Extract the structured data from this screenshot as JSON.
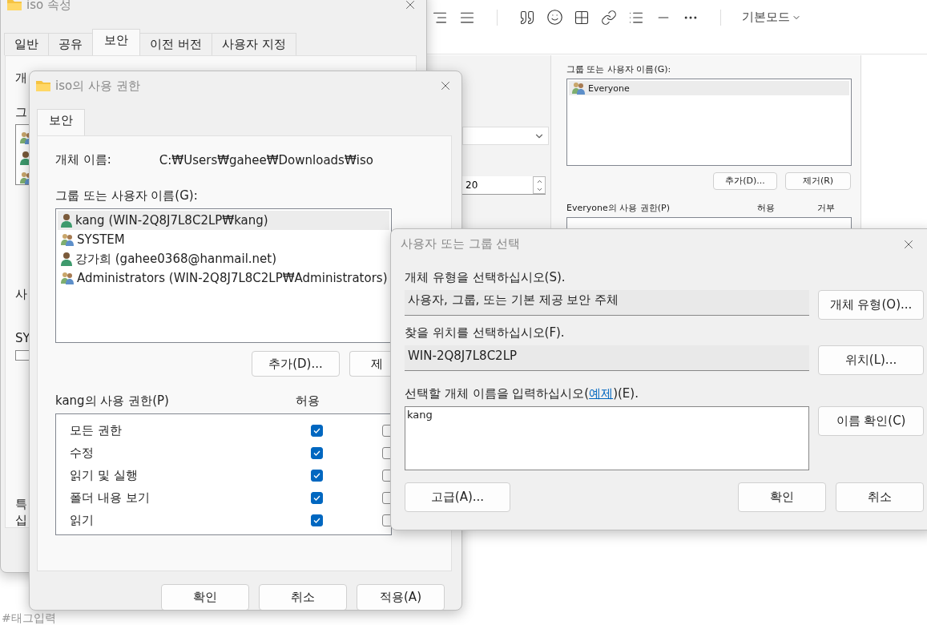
{
  "editor": {
    "mode_menu": "기본모드",
    "tag_input": {
      "placeholder": "#태그입력"
    },
    "spin_value": "20"
  },
  "shared_panel": {
    "group_label": "그룹 또는 사용자 이름(G):",
    "principals": [
      {
        "name": "Everyone",
        "kind": "group",
        "selected": true
      }
    ],
    "buttons": [
      "추가(D)...",
      "제거(R)"
    ],
    "permissions_label": "Everyone의 사용 권한(P)",
    "allow_header": "허용",
    "deny_header": "거부"
  },
  "properties_window": {
    "title": "iso 속성",
    "tabs": [
      {
        "label": "일반",
        "selected": false
      },
      {
        "label": "공유",
        "selected": false
      },
      {
        "label": "보안",
        "selected": true
      },
      {
        "label": "이전 버전",
        "selected": false
      },
      {
        "label": "사용자 지정",
        "selected": false
      }
    ],
    "clipped_labels": [
      "개",
      "그",
      "사",
      "SY",
      "특",
      "십"
    ]
  },
  "permissions_dialog": {
    "title": "iso의 사용 권한",
    "tabs": [
      {
        "label": "보안",
        "selected": true
      }
    ],
    "object_label": "개체 이름:",
    "object_value": "C:₩Users₩gahee₩Downloads₩iso",
    "group_label": "그룹 또는 사용자 이름(G):",
    "principals": [
      {
        "name": "kang (WIN-2Q8J7L8C2LP₩kang)",
        "kind": "user",
        "selected": true
      },
      {
        "name": "SYSTEM",
        "kind": "group",
        "selected": false
      },
      {
        "name": "강가희 (gahee0368@hanmail.net)",
        "kind": "user",
        "selected": false
      },
      {
        "name": "Administrators (WIN-2Q8J7L8C2LP₩Administrators)",
        "kind": "group",
        "selected": false
      }
    ],
    "add_button": "추가(D)...",
    "remove_button": "제",
    "permissions_label": "kang의 사용 권한(P)",
    "allow_header": "허용",
    "permissions": [
      {
        "name": "모든 권한",
        "allow": true,
        "deny": false
      },
      {
        "name": "수정",
        "allow": true,
        "deny": false
      },
      {
        "name": "읽기 및 실행",
        "allow": true,
        "deny": false
      },
      {
        "name": "폴더 내용 보기",
        "allow": true,
        "deny": false
      },
      {
        "name": "읽기",
        "allow": true,
        "deny": false
      }
    ],
    "buttons": [
      "확인",
      "취소",
      "적용(A)"
    ]
  },
  "select_dialog": {
    "title": "사용자 또는 그룹 선택",
    "type_label": "개체 유형을 선택하십시오(S).",
    "type_value": "사용자, 그룹, 또는 기본 제공 보안 주체",
    "type_button": "개체 유형(O)...",
    "location_label": "찾을 위치를 선택하십시오(F).",
    "location_value": "WIN-2Q8J7L8C2LP",
    "location_button": "위치(L)...",
    "names_label_before": "선택할 개체 이름을 입력하십시오(",
    "names_link": "예제",
    "names_label_after": ")(E).",
    "names_value": "kang",
    "check_button": "이름 확인(C)",
    "advanced_button": "고급(A)...",
    "buttons": [
      "확인",
      "취소"
    ]
  }
}
